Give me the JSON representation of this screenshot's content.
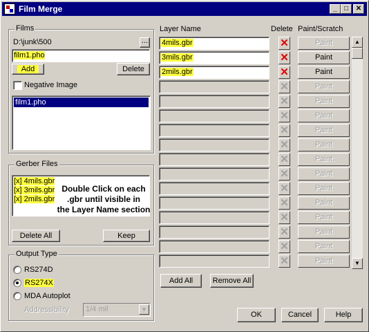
{
  "window": {
    "title": "Film Merge",
    "minimize_glyph": "_",
    "maximize_glyph": "□",
    "close_glyph": "✕"
  },
  "films": {
    "group_label": "Films",
    "path": "D:\\junk\\500",
    "browse_label": "...",
    "filename_value": "film1.pho",
    "add_label": "Add",
    "delete_label": "Delete",
    "negative_label": "Negative Image",
    "negative_checked": false,
    "list": [
      "film1.pho"
    ]
  },
  "gerber": {
    "group_label": "Gerber Files",
    "items": [
      "[x] 4mils.gbr",
      "[x] 3mils.gbr",
      "[x] 2mils.gbr"
    ],
    "hint_lines": [
      "Double Click on each",
      ".gbr until visible in",
      "the Layer Name section"
    ],
    "delete_all_label": "Delete All",
    "keep_label": "Keep"
  },
  "output": {
    "group_label": "Output Type",
    "options": [
      "RS274D",
      "RS274X",
      "MDA Autoplot"
    ],
    "selected": "RS274X",
    "addressibility_label": "Addressibility",
    "addressibility_value": "1/4 mil"
  },
  "layers": {
    "header_name": "Layer Name",
    "header_delete": "Delete",
    "header_paint": "Paint/Scratch",
    "paint_label": "Paint",
    "delete_glyph": "✕",
    "rows": [
      {
        "name": "4mils.gbr",
        "active": true
      },
      {
        "name": "3mils.gbr",
        "active": true
      },
      {
        "name": "2mils.gbr",
        "active": true
      },
      {
        "name": "",
        "active": false
      },
      {
        "name": "",
        "active": false
      },
      {
        "name": "",
        "active": false
      },
      {
        "name": "",
        "active": false
      },
      {
        "name": "",
        "active": false
      },
      {
        "name": "",
        "active": false
      },
      {
        "name": "",
        "active": false
      },
      {
        "name": "",
        "active": false
      },
      {
        "name": "",
        "active": false
      },
      {
        "name": "",
        "active": false
      },
      {
        "name": "",
        "active": false
      },
      {
        "name": "",
        "active": false
      },
      {
        "name": "",
        "active": false
      }
    ],
    "add_all_label": "Add All",
    "remove_all_label": "Remove All"
  },
  "footer": {
    "ok_label": "OK",
    "cancel_label": "Cancel",
    "help_label": "Help"
  },
  "colors": {
    "title_bar": "#000080",
    "highlight": "#ffff40",
    "selection": "#000080",
    "delete_active": "#e00000",
    "face": "#d4d0c8"
  }
}
